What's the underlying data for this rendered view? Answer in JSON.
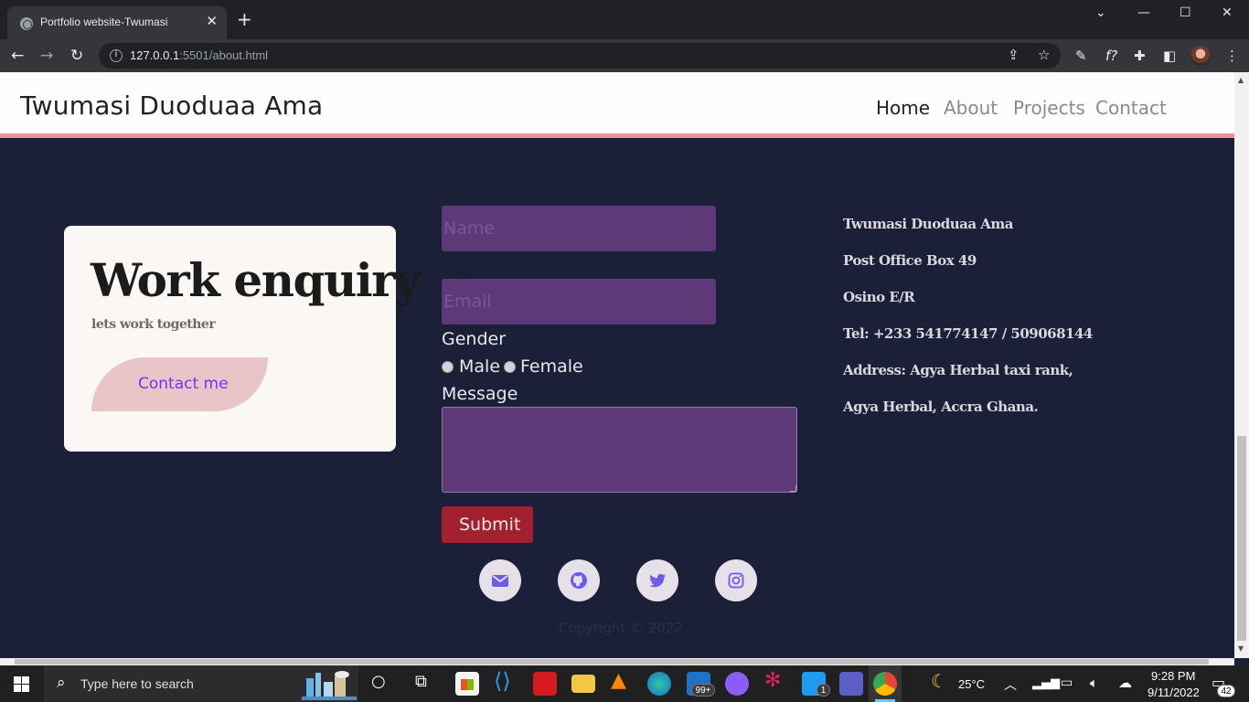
{
  "browser": {
    "tab_title": "Portfolio website-Twumasi",
    "url_host": "127.0.0.1",
    "url_rest": ":5501/about.html"
  },
  "site": {
    "brand": "Twumasi Duoduaa Ama",
    "nav": [
      {
        "label": "Home",
        "active": true
      },
      {
        "label": "About"
      },
      {
        "label": "Projects"
      },
      {
        "label": "Contact"
      }
    ]
  },
  "card": {
    "title": "Work enquiry",
    "subtitle": "lets work together",
    "button": "Contact me"
  },
  "form": {
    "name_placeholder": "Name",
    "email_placeholder": "Email",
    "gender_label": "Gender",
    "gender_options": [
      "Male",
      "Female"
    ],
    "message_label": "Message",
    "submit_label": "Submit"
  },
  "social": [
    "envelope-icon",
    "github-icon",
    "twitter-icon",
    "instagram-icon"
  ],
  "copyright": "Copyright © 2022",
  "address": [
    "Twumasi Duoduaa Ama",
    "Post Office Box 49",
    "Osino E/R",
    "Tel: +233 541774147 / 509068144",
    "Address: Agya Herbal taxi rank,",
    "Agya Herbal, Accra Ghana."
  ],
  "taskbar": {
    "search_placeholder": "Type here to search",
    "weather": "25°C",
    "time": "9:28 PM",
    "date": "9/11/2022",
    "mail_badge": "99+",
    "twitter_badge": "1",
    "notif_count": "42"
  },
  "colors": {
    "page_bg": "#1c1f38",
    "nav_border": "#f08f99",
    "field_bg": "#5e3978",
    "submit_bg": "#a3202e",
    "contact_btn_bg": "#e9c5c7",
    "social_icon": "#6c5ce7"
  }
}
